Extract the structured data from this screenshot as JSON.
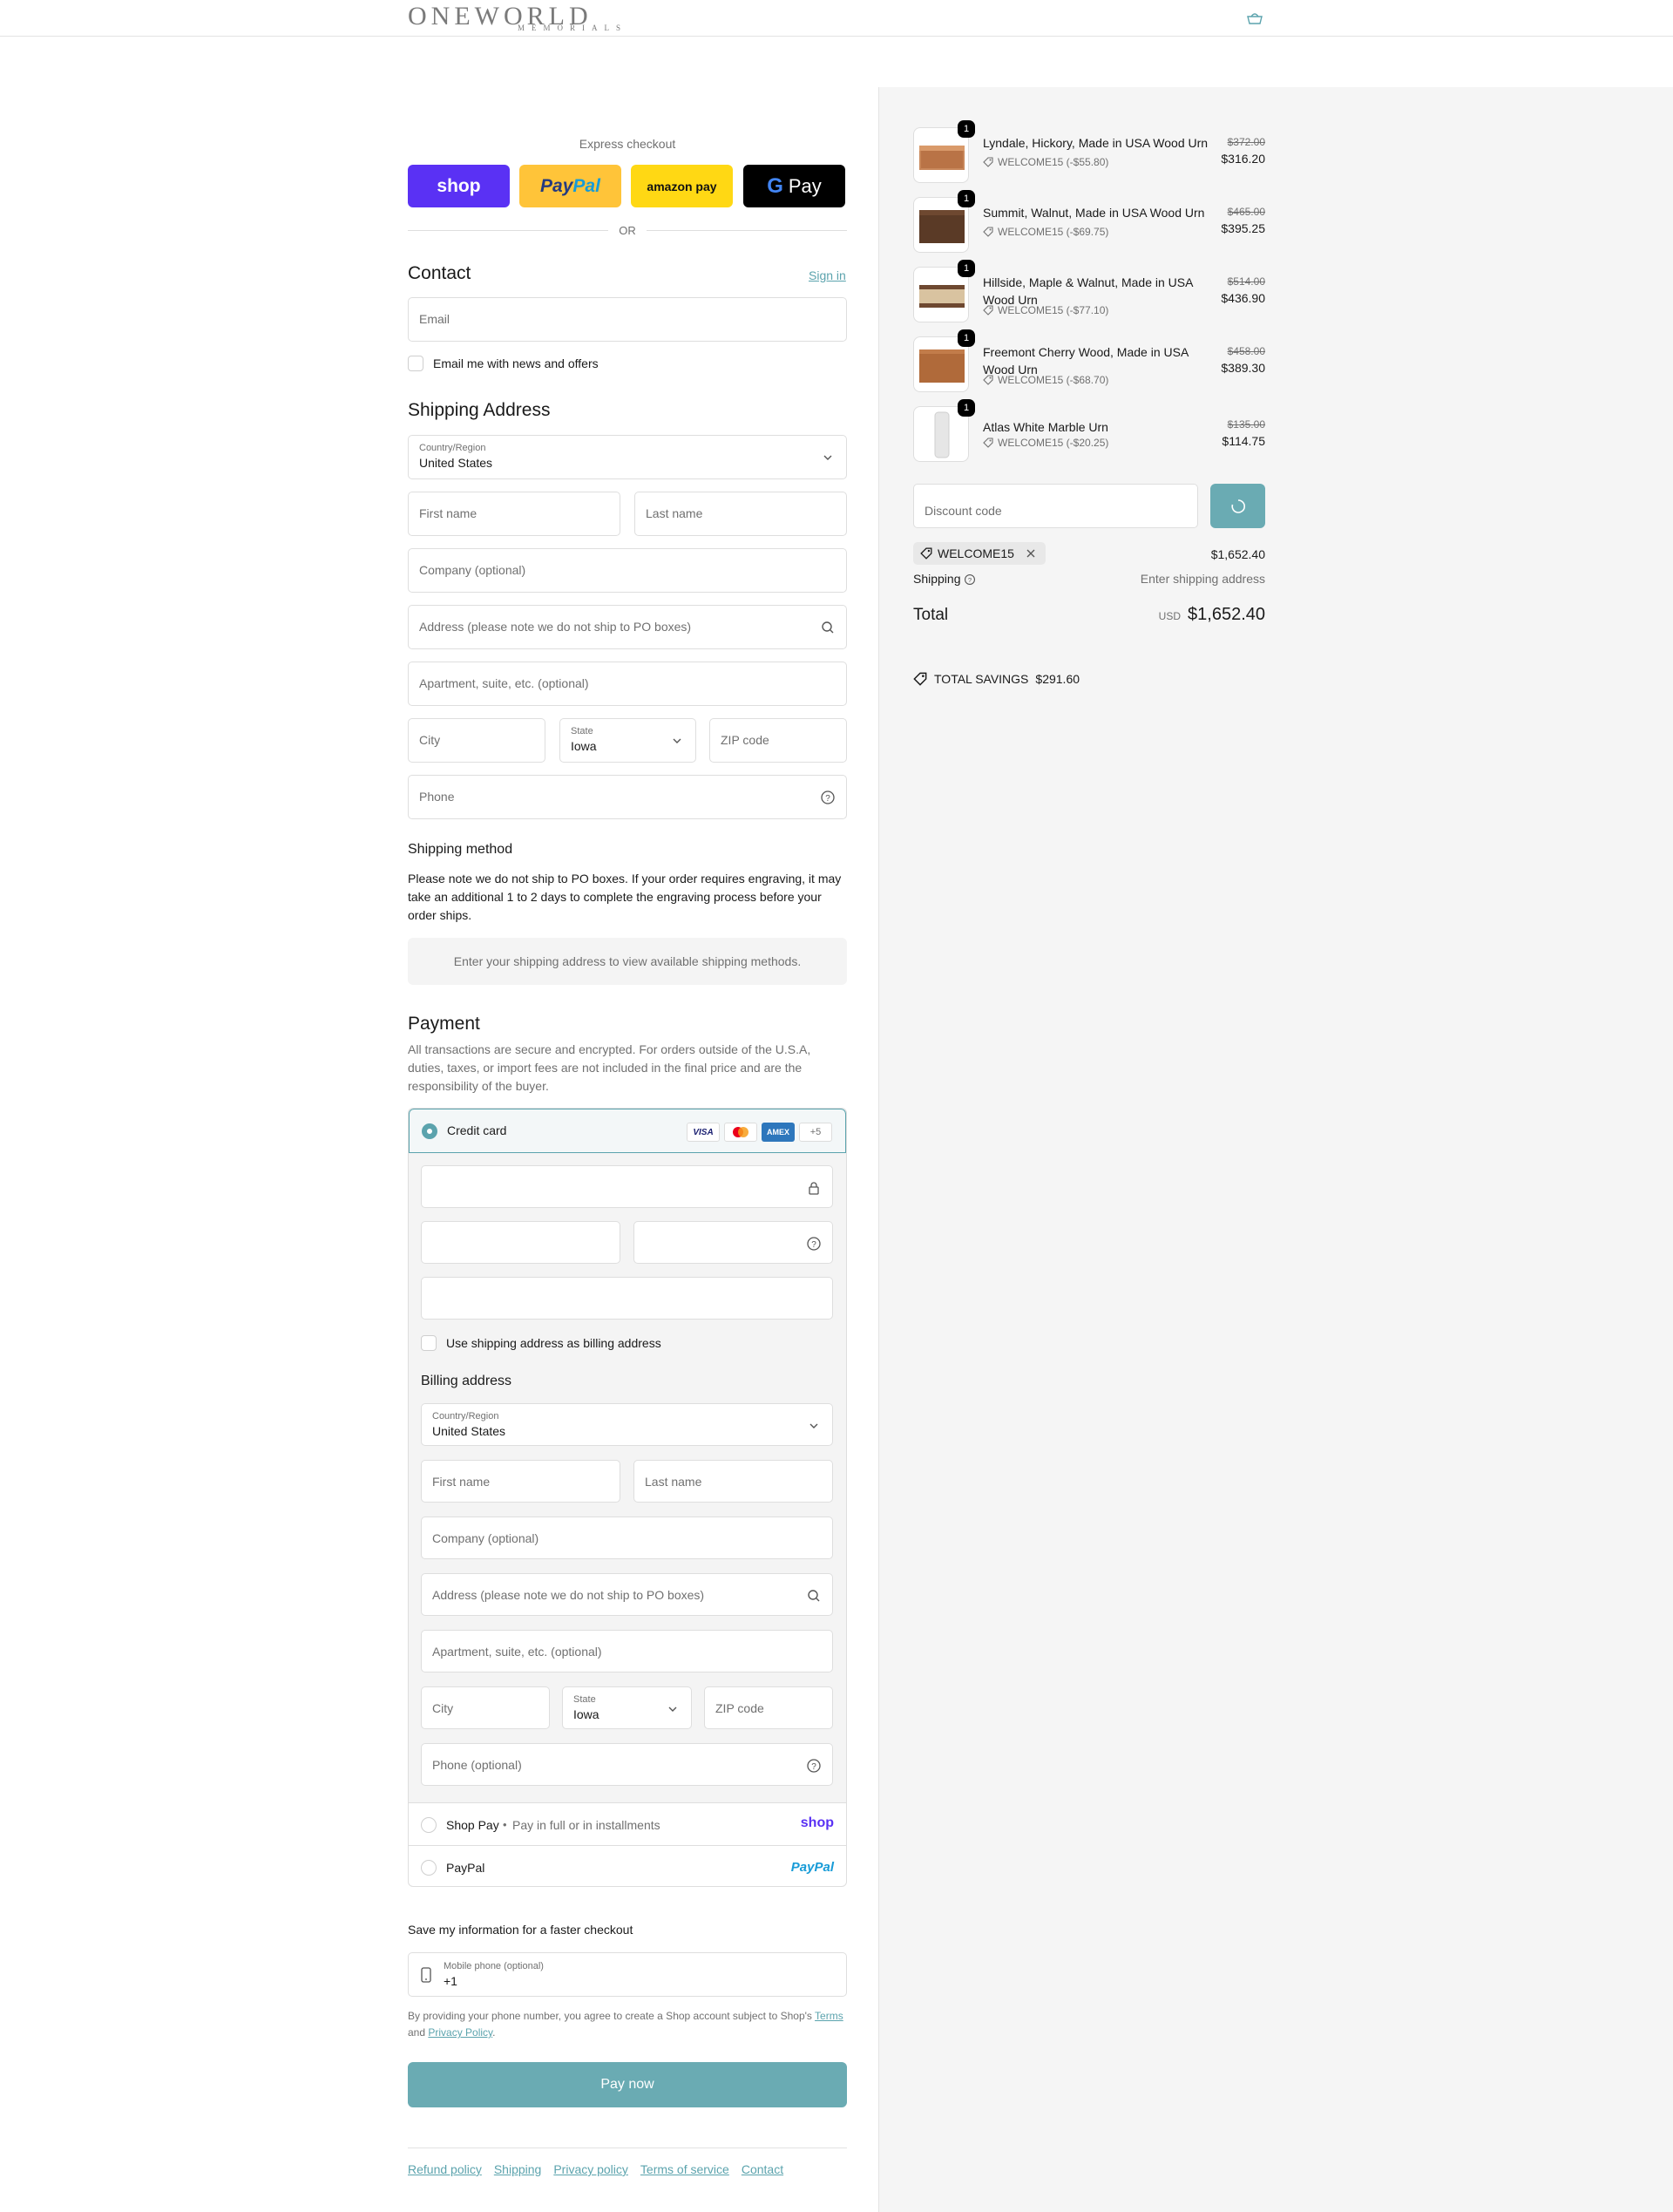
{
  "header": {
    "logo_big": "ONEWORLD",
    "logo_small": "MEMORIALS"
  },
  "express": {
    "label": "Express checkout",
    "shop_label": "shop",
    "paypal_label_1": "Pay",
    "paypal_label_2": "Pal",
    "amazon_label": "amazon pay",
    "gpay_label": "Pay",
    "or": "OR"
  },
  "contact": {
    "title": "Contact",
    "signin": "Sign in",
    "email_placeholder": "Email",
    "news_label": "Email me with news and offers"
  },
  "shipping": {
    "title": "Shipping Address",
    "country_label": "Country/Region",
    "country_value": "United States",
    "first_name": "First name",
    "last_name": "Last name",
    "company": "Company (optional)",
    "address": "Address (please note we do not ship to PO boxes)",
    "apartment": "Apartment, suite, etc. (optional)",
    "city": "City",
    "state_label": "State",
    "state_value": "Iowa",
    "zip": "ZIP code",
    "phone": "Phone"
  },
  "shipping_method": {
    "title": "Shipping method",
    "note": "Please note we do not ship to PO boxes. If your order requires engraving, it may take an additional 1 to 2 days to complete the engraving process before your order ships.",
    "placeholder": "Enter your shipping address to view available shipping methods."
  },
  "payment": {
    "title": "Payment",
    "description": "All transactions are secure and encrypted. For orders outside of the U.S.A, duties, taxes, or import fees are not included in the final price and are the responsibility of the buyer.",
    "credit_card_label": "Credit card",
    "card_visa": "VISA",
    "card_amex": "AMEX",
    "card_more": "+5",
    "use_shipping_label": "Use shipping address as billing address",
    "shop_pay_label": "Shop Pay",
    "shop_pay_sub": "Pay in full or in installments",
    "shop_pay_logo": "shop",
    "paypal_label": "PayPal",
    "paypal_logo": "PayPal"
  },
  "billing": {
    "title": "Billing address",
    "country_label": "Country/Region",
    "country_value": "United States",
    "first_name": "First name",
    "last_name": "Last name",
    "company": "Company (optional)",
    "address": "Address (please note we do not ship to PO boxes)",
    "apartment": "Apartment, suite, etc. (optional)",
    "city": "City",
    "state_label": "State",
    "state_value": "Iowa",
    "zip": "ZIP code",
    "phone": "Phone (optional)"
  },
  "save_info": {
    "title": "Save my information for a faster checkout",
    "mobile_label": "Mobile phone (optional)",
    "mobile_value": "+1",
    "legal_pre": "By providing your phone number, you agree to create a Shop account subject to Shop's",
    "terms": "Terms",
    "and": "and",
    "privacy": "Privacy Policy",
    "period": "."
  },
  "pay_now": "Pay now",
  "footer": {
    "refund": "Refund policy",
    "shipping": "Shipping",
    "privacy": "Privacy policy",
    "terms": "Terms of service",
    "contact": "Contact"
  },
  "summary": {
    "items": [
      {
        "qty": "1",
        "name": "Lyndale, Hickory, Made in USA Wood Urn",
        "discount": "WELCOME15 (-$55.80)",
        "original": "$372.00",
        "price": "$316.20"
      },
      {
        "qty": "1",
        "name": "Summit, Walnut, Made in USA Wood Urn",
        "discount": "WELCOME15 (-$69.75)",
        "original": "$465.00",
        "price": "$395.25"
      },
      {
        "qty": "1",
        "name": "Hillside, Maple & Walnut, Made in USA Wood Urn",
        "discount": "WELCOME15 (-$77.10)",
        "original": "$514.00",
        "price": "$436.90"
      },
      {
        "qty": "1",
        "name": "Freemont Cherry Wood, Made in USA Wood Urn",
        "discount": "WELCOME15 (-$68.70)",
        "original": "$458.00",
        "price": "$389.30"
      },
      {
        "qty": "1",
        "name": "Atlas White Marble Urn",
        "discount": "WELCOME15 (-$20.25)",
        "original": "$135.00",
        "price": "$114.75"
      }
    ],
    "discount_placeholder": "Discount code",
    "applied_code": "WELCOME15",
    "subtotal": "$1,652.40",
    "shipping_label": "Shipping",
    "shipping_value": "Enter shipping address",
    "total_label": "Total",
    "currency": "USD",
    "total": "$1,652.40",
    "savings_label": "TOTAL SAVINGS",
    "savings_value": "$291.60"
  },
  "colors": {
    "accent": "#6aabb3",
    "shop_purple": "#5a31f4",
    "paypal_yellow": "#ffc439",
    "amazon_yellow": "#ffd814"
  }
}
